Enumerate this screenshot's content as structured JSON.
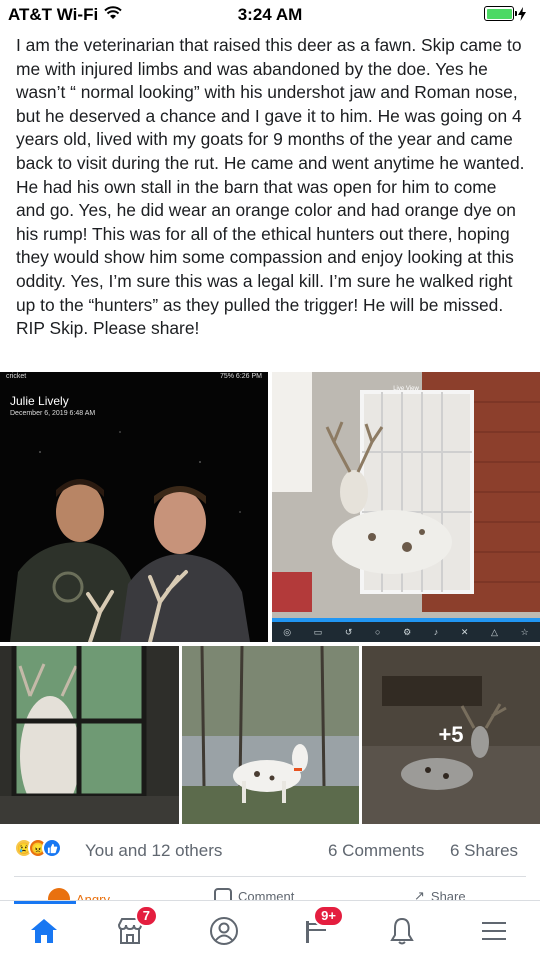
{
  "status_bar": {
    "carrier": "AT&T Wi-Fi",
    "time": "3:24 AM"
  },
  "post": {
    "text": "I am the veterinarian that raised this deer as a fawn. Skip came to me with injured limbs and was abandoned by the doe. Yes he wasn’t “ normal looking” with his undershot jaw and Roman nose, but he deserved a chance and I gave it to him. He was going on 4 years old, lived with my goats for 9 months of the year and came back to visit during the rut. He came and went anytime he wanted. He had his own stall in the barn that was open for him to come and go. Yes, he did wear an orange color and had orange dye on his rump!  This was for all of the ethical hunters out there, hoping they would show him some compassion and enjoy looking at this oddity. Yes, I’m sure this was a legal kill. I’m sure he walked right up to the “hunters” as they pulled the trigger!  He will be missed. RIP Skip. Please share!"
  },
  "photos": {
    "photo1": {
      "phone_carrier": "cricket",
      "phone_battery": "75%",
      "phone_time": "6:26 PM",
      "name": "Julie Lively",
      "date": "December 6, 2019 6:48 AM"
    },
    "photo2": {
      "caption": "Live View"
    },
    "more_count": "+5"
  },
  "reactions": {
    "label": "You and 12 others",
    "comments": "6 Comments",
    "shares": "6 Shares"
  },
  "actions": {
    "react": "Angry",
    "comment": "Comment",
    "share": "Share"
  },
  "nav": {
    "marketplace_badge": "7",
    "groups_badge": "9+",
    "accent": "#1877f2",
    "badge_color": "#e41e3f"
  }
}
